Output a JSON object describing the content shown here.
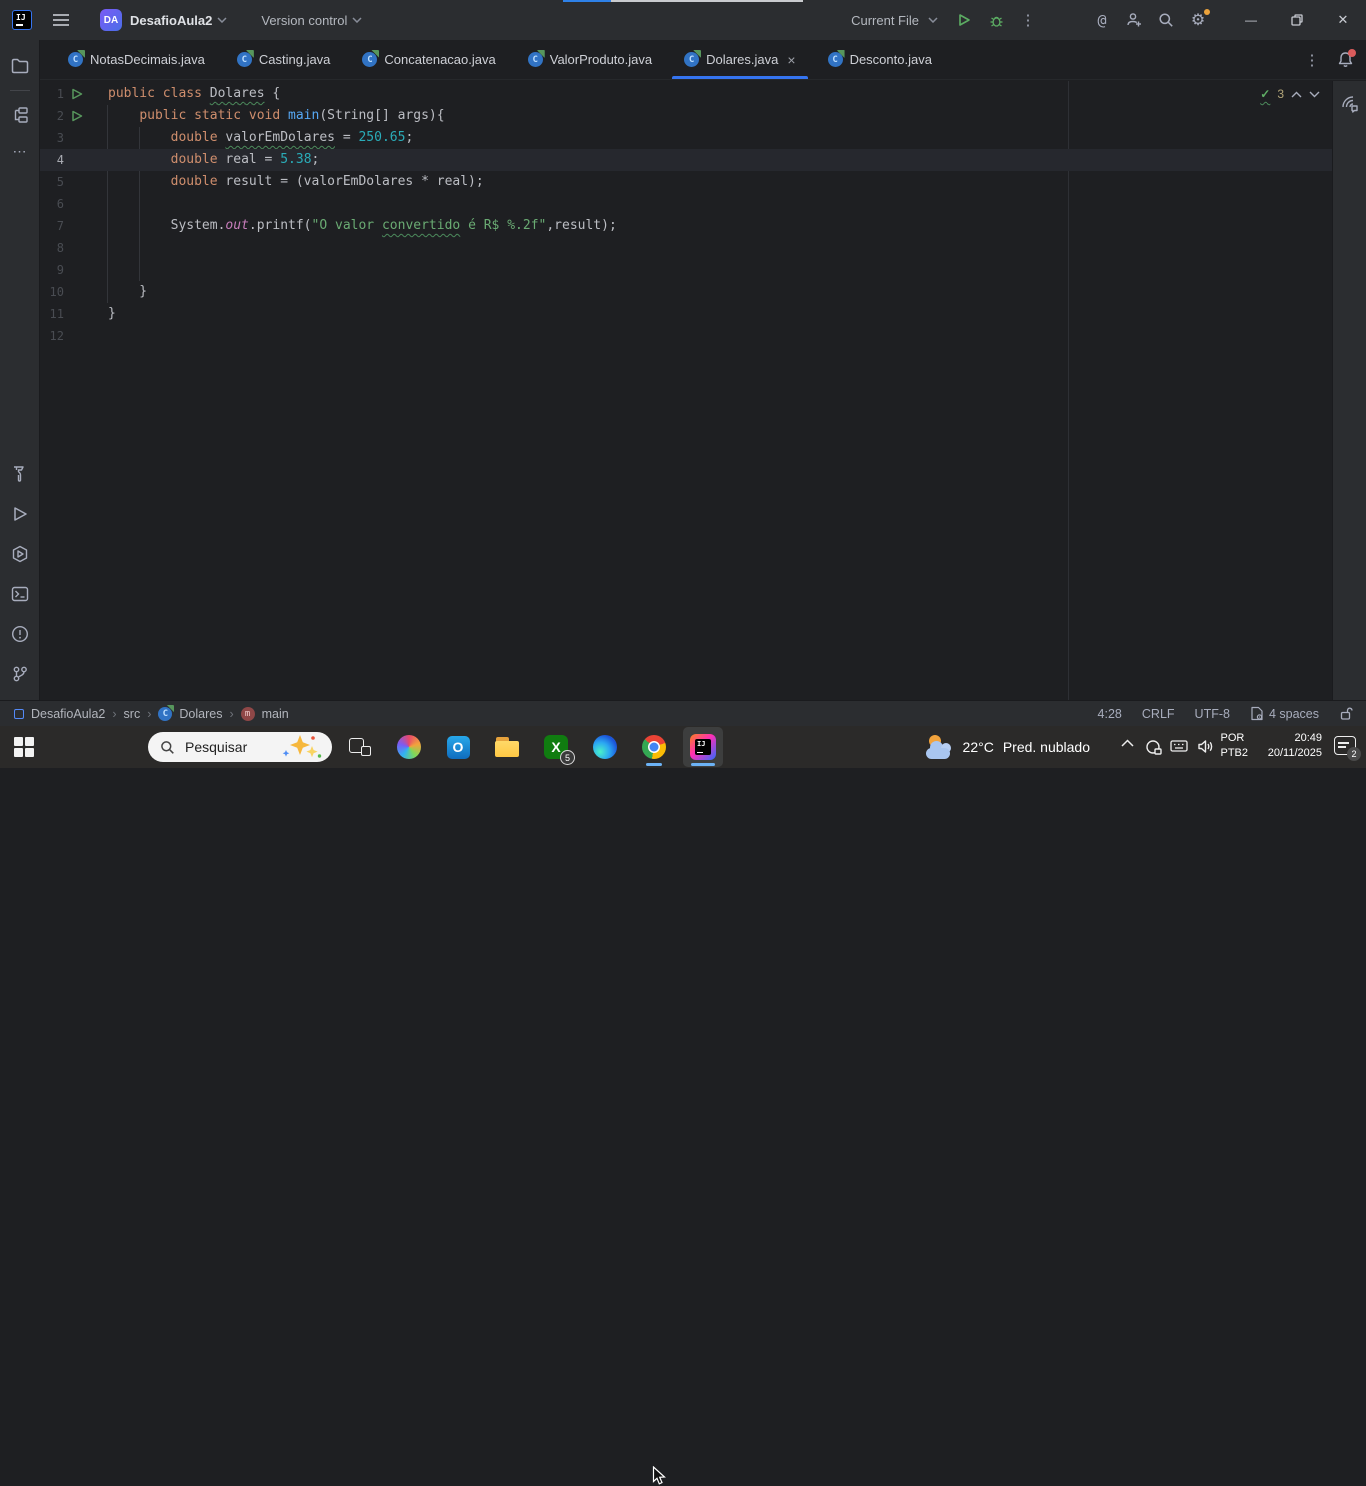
{
  "icons": {
    "more_vertical": "⋮",
    "more_horizontal": "⋯",
    "at_spiral": "@",
    "gear": "⚙",
    "minimize": "—",
    "close": "✕",
    "tab_close": "×",
    "breadcrumb_sep": "›",
    "check": "✓",
    "class_letter": "C",
    "method_letter": "m"
  },
  "title_bar": {
    "logo_text": "IJ",
    "project_badge": "DA",
    "project_name": "DesafioAula2",
    "version_control_label": "Version control",
    "run_config_label": "Current File"
  },
  "tabs": {
    "items": [
      {
        "label": "NotasDecimais.java",
        "active": false
      },
      {
        "label": "Casting.java",
        "active": false
      },
      {
        "label": "Concatenacao.java",
        "active": false
      },
      {
        "label": "ValorProduto.java",
        "active": false
      },
      {
        "label": "Dolares.java",
        "active": true
      },
      {
        "label": "Desconto.java",
        "active": false
      }
    ]
  },
  "editor": {
    "inspection_count": "3",
    "lines": [
      {
        "n": "1",
        "run": true,
        "current": false,
        "segs": [
          [
            "kw",
            "public class "
          ],
          [
            "idw",
            "Dolares"
          ],
          [
            "pl",
            " {"
          ]
        ]
      },
      {
        "n": "2",
        "run": true,
        "current": false,
        "segs": [
          [
            "pl",
            "    "
          ],
          [
            "kw",
            "public static void "
          ],
          [
            "fn",
            "main"
          ],
          [
            "pl",
            "(String[] args){"
          ]
        ]
      },
      {
        "n": "3",
        "run": false,
        "current": false,
        "segs": [
          [
            "pl",
            "        "
          ],
          [
            "kw",
            "double"
          ],
          [
            "pl",
            " "
          ],
          [
            "idw",
            "valorEmDolares"
          ],
          [
            "pl",
            " = "
          ],
          [
            "num",
            "250.65"
          ],
          [
            "pl",
            ";"
          ]
        ]
      },
      {
        "n": "4",
        "run": false,
        "current": true,
        "segs": [
          [
            "pl",
            "        "
          ],
          [
            "kw",
            "double"
          ],
          [
            "pl",
            " real = "
          ],
          [
            "num",
            "5.38"
          ],
          [
            "pl",
            ";"
          ]
        ]
      },
      {
        "n": "5",
        "run": false,
        "current": false,
        "segs": [
          [
            "pl",
            "        "
          ],
          [
            "kw",
            "double"
          ],
          [
            "pl",
            " result = (valorEmDolares * real);"
          ]
        ]
      },
      {
        "n": "6",
        "run": false,
        "current": false,
        "segs": []
      },
      {
        "n": "7",
        "run": false,
        "current": false,
        "segs": [
          [
            "pl",
            "        System."
          ],
          [
            "fld",
            "out"
          ],
          [
            "pl",
            ".printf("
          ],
          [
            "str",
            "\"O valor "
          ],
          [
            "strw",
            "convertido"
          ],
          [
            "str",
            " é R$ %.2f\""
          ],
          [
            "pl",
            ",result);"
          ]
        ]
      },
      {
        "n": "8",
        "run": false,
        "current": false,
        "segs": []
      },
      {
        "n": "9",
        "run": false,
        "current": false,
        "segs": []
      },
      {
        "n": "10",
        "run": false,
        "current": false,
        "segs": [
          [
            "pl",
            "    }"
          ]
        ]
      },
      {
        "n": "11",
        "run": false,
        "current": false,
        "segs": [
          [
            "pl",
            "}"
          ]
        ]
      },
      {
        "n": "12",
        "run": false,
        "current": false,
        "segs": []
      }
    ]
  },
  "status_bar": {
    "breadcrumbs": [
      "DesafioAula2",
      "src",
      "Dolares",
      "main"
    ],
    "caret_position": "4:28",
    "line_separator": "CRLF",
    "encoding": "UTF-8",
    "indent": "4 spaces"
  },
  "taskbar": {
    "search_placeholder": "Pesquisar",
    "xbox_badge": "5",
    "weather_temp": "22°C",
    "weather_desc": "Pred. nublado",
    "lang_line1": "POR",
    "lang_line2": "PTB2",
    "time": "20:49",
    "date": "20/11/2025",
    "notification_count": "2",
    "idea_logo_text": "IJ",
    "outlook_letter": "O",
    "xbox_letter": "X"
  },
  "colors": {
    "accent_blue": "#3574F0",
    "run_green": "#5CAD63",
    "keyword": "#CF8E6D",
    "number": "#2AACB8",
    "string": "#6AAB73",
    "method": "#56A8F5",
    "field": "#C77DBB",
    "editor_bg": "#1E1F22",
    "panel_bg": "#2B2D30",
    "taskbar_bg": "#2B2A29",
    "win_accent_underline": "#6CB2F5"
  }
}
